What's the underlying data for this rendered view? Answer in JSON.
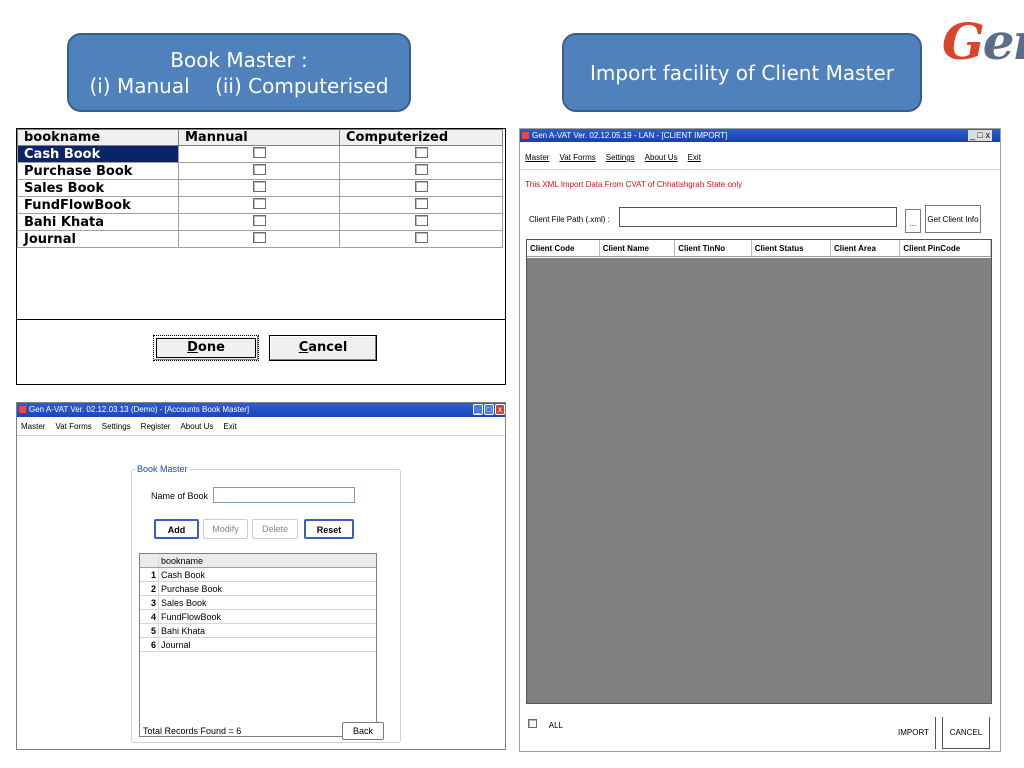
{
  "callouts": {
    "book_master": {
      "line1": "Book Master :",
      "line2": "(i) Manual    (ii) Computerised"
    },
    "import": {
      "text": "Import facility of Client Master"
    }
  },
  "logo": {
    "text_g": "G",
    "text_rest": "en"
  },
  "book_grid": {
    "columns": [
      "bookname",
      "Mannual",
      "Computerized"
    ],
    "rows": [
      {
        "name": "Cash Book",
        "selected": true
      },
      {
        "name": "Purchase Book",
        "selected": false
      },
      {
        "name": "Sales Book",
        "selected": false
      },
      {
        "name": "FundFlowBook",
        "selected": false
      },
      {
        "name": "Bahi Khata",
        "selected": false
      },
      {
        "name": "Journal",
        "selected": false
      }
    ],
    "done_label_u": "D",
    "done_label_rest": "one",
    "cancel_label_u": "C",
    "cancel_label_rest": "ancel"
  },
  "accounts_window": {
    "title": "Gen A-VAT Ver. 02.12.03.13 (Demo) - [Accounts Book Master]",
    "menu": [
      "Master",
      "Vat Forms",
      "Settings",
      "Register",
      "About Us",
      "Exit"
    ],
    "group_title": "Book Master",
    "name_label": "Name of Book",
    "name_value": "",
    "buttons": {
      "add": "Add",
      "modify": "Modify",
      "delete": "Delete",
      "reset": "Reset"
    },
    "grid_header": "bookname",
    "rows": [
      {
        "num": "1",
        "name": "Cash Book"
      },
      {
        "num": "2",
        "name": "Purchase Book"
      },
      {
        "num": "3",
        "name": "Sales Book"
      },
      {
        "num": "4",
        "name": "FundFlowBook"
      },
      {
        "num": "5",
        "name": "Bahi Khata"
      },
      {
        "num": "6",
        "name": "Journal"
      }
    ],
    "total": "Total Records Found = 6",
    "back": "Back"
  },
  "import_window": {
    "title": "Gen A-VAT Ver. 02.12.05.19 - LAN - [CLIENT IMPORT]",
    "menu": [
      "Master",
      "Vat Forms",
      "Settings",
      "About Us",
      "Exit"
    ],
    "notice": "This XML Import Data From CVAT of Chhatishgrah State only",
    "path_label": "Client File Path (.xml) :",
    "path_value": "",
    "browse": "...",
    "get_info": "Get Client Info",
    "columns": [
      "Client Code",
      "Client Name",
      "Client TinNo",
      "Client Status",
      "Client Area",
      "Client PinCode"
    ],
    "all_label": "ALL",
    "import_btn": "IMPORT",
    "cancel_btn": "CANCEL",
    "window_controls": [
      "_",
      "□",
      "x"
    ]
  }
}
